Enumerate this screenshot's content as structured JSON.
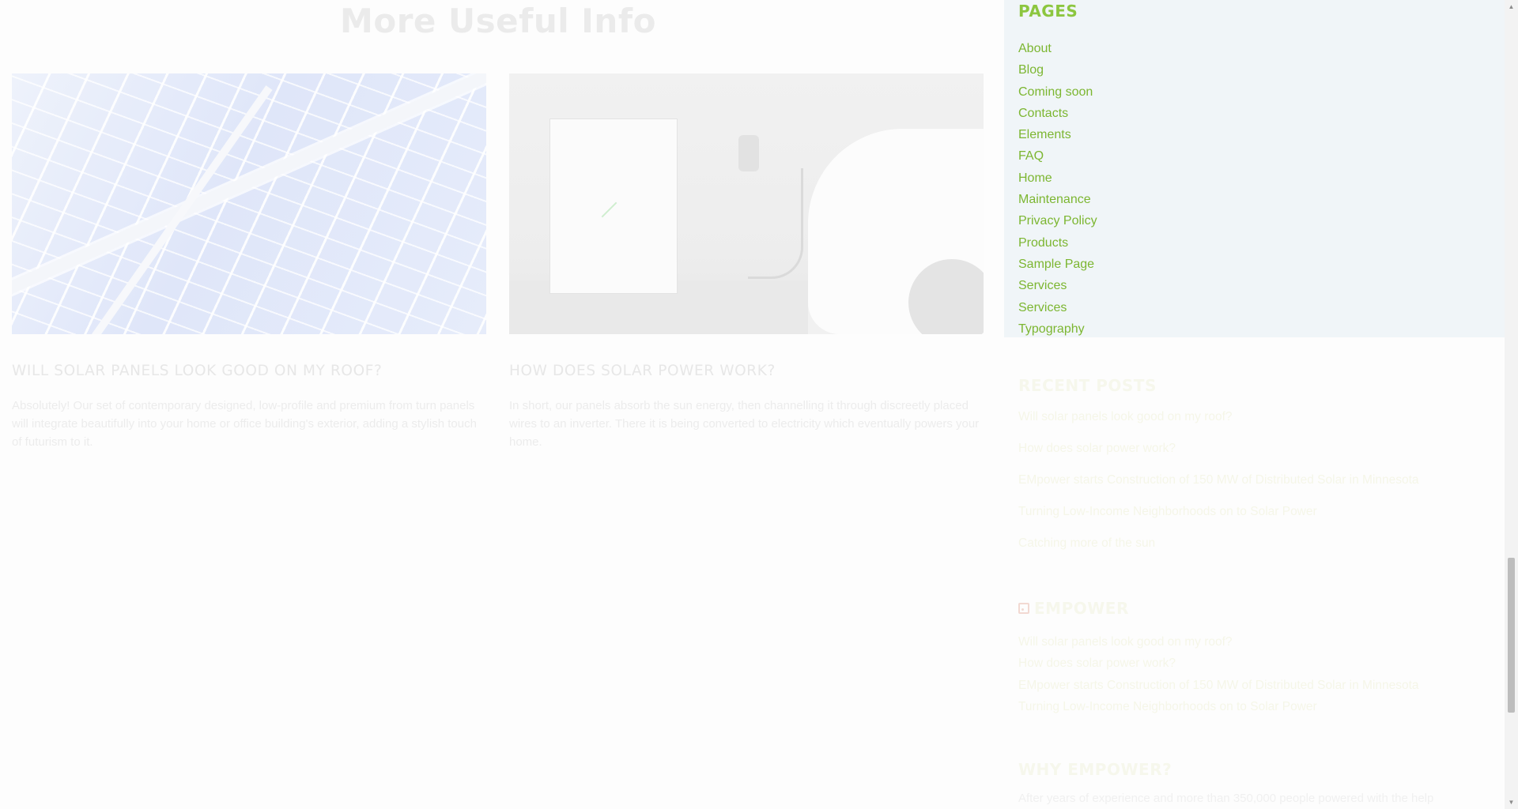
{
  "main": {
    "section_title": "More Useful Info",
    "cards": [
      {
        "image_alt": "solar panels",
        "title": "WILL SOLAR PANELS LOOK GOOD ON MY ROOF?",
        "excerpt": "Absolutely! Our set of contemporary designed, low-profile and premium from turn panels will integrate beautifully into your home or office building's exterior, adding a stylish touch of futurism to it."
      },
      {
        "image_alt": "home battery and electric car charging",
        "title": "HOW DOES SOLAR POWER WORK?",
        "excerpt": "In short, our panels absorb the sun energy, then channelling it through discreetly placed wires to an inverter. There it is being converted to electricity which eventually powers your home."
      }
    ]
  },
  "sidebar": {
    "pages": {
      "title": "PAGES",
      "items": [
        "About",
        "Blog",
        "Coming soon",
        "Contacts",
        "Elements",
        "FAQ",
        "Home",
        "Maintenance",
        "Privacy Policy",
        "Products",
        "Sample Page",
        "Services",
        "Services",
        "Typography"
      ]
    },
    "recent_posts": {
      "title": "RECENT POSTS",
      "items": [
        "Will solar panels look good on my roof?",
        "How does solar power work?",
        "EMpower starts Construction of 150 MW of Distributed Solar in Minnesota",
        "Turning Low-Income Neighborhoods on to Solar Power",
        "Catching more of the sun"
      ]
    },
    "empower_feed": {
      "title": "EMPOWER",
      "icon": "rss-icon",
      "items": [
        "Will solar panels look good on my roof?",
        "How does solar power work?",
        "EMpower starts Construction of 150 MW of Distributed Solar in Minnesota",
        "Turning Low-Income Neighborhoods on to Solar Power"
      ]
    },
    "why_empower": {
      "title": "WHY EMPOWER?",
      "text": "After years of experience and more than 350,000 people powered with the help"
    }
  },
  "colors": {
    "accent_green": "#8cc63f",
    "link_green": "#7cb631",
    "pages_background": "#f0f5f8"
  }
}
